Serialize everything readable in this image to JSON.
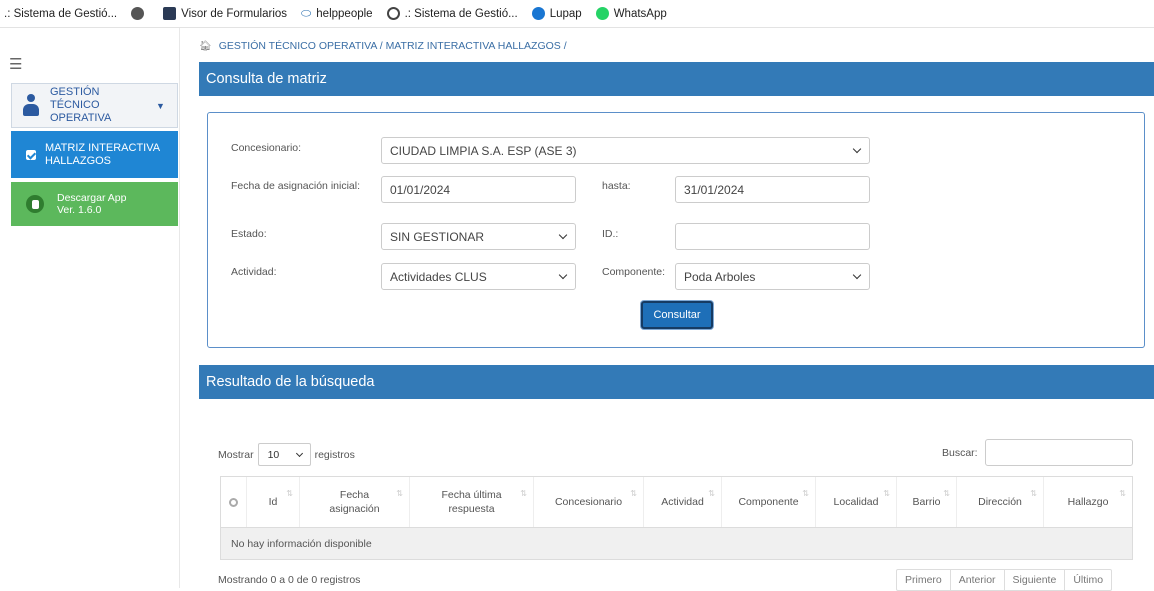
{
  "bookmarks": [
    {
      "label": ".: Sistema de Gestió...",
      "icon": "none"
    },
    {
      "label": "",
      "icon": "chrome-icon"
    },
    {
      "label": "Visor de Formularios",
      "icon": "document-icon"
    },
    {
      "label": "helppeople",
      "icon": "link-icon"
    },
    {
      "label": ".: Sistema de Gestió...",
      "icon": "owl-icon"
    },
    {
      "label": "Lupap",
      "icon": "globe-icon"
    },
    {
      "label": "WhatsApp",
      "icon": "whatsapp-icon"
    }
  ],
  "sidebar": {
    "group": "GESTIÓN TÉCNICO OPERATIVA",
    "active_item": "MATRIZ INTERACTIVA HALLAZGOS",
    "app_item": {
      "line1": "Descargar App",
      "line2": "Ver. 1.6.0"
    },
    "colors": {
      "active": "#1f86d4",
      "app": "#5cb85c"
    }
  },
  "breadcrumb": "GESTIÓN TÉCNICO OPERATIVA / MATRIZ INTERACTIVA HALLAZGOS /",
  "query_panel": {
    "title": "Consulta de matriz",
    "concesionario_label": "Concesionario:",
    "concesionario_value": "CIUDAD LIMPIA S.A. ESP (ASE 3)",
    "fecha_label": "Fecha de asignación inicial:",
    "fecha_value": "01/01/2024",
    "hasta_label": "hasta:",
    "hasta_value": "31/01/2024",
    "estado_label": "Estado:",
    "estado_value": "SIN GESTIONAR",
    "id_label": "ID.:",
    "id_value": "",
    "actividad_label": "Actividad:",
    "actividad_value": "Actividades CLUS",
    "componente_label": "Componente:",
    "componente_value": "Poda Arboles",
    "submit_label": "Consultar"
  },
  "results_panel": {
    "title": "Resultado de la búsqueda",
    "show_prefix": "Mostrar",
    "page_length": "10",
    "show_suffix": "registros",
    "search_label": "Buscar:",
    "columns": [
      "Id",
      "Fecha asignación",
      "Fecha última respuesta",
      "Concesionario",
      "Actividad",
      "Componente",
      "Localidad",
      "Barrio",
      "Dirección",
      "Hallazgo"
    ],
    "empty_message": "No hay información disponible",
    "info": "Mostrando 0 a 0 de 0 registros",
    "pager": [
      "Primero",
      "Anterior",
      "Siguiente",
      "Último"
    ]
  },
  "colors": {
    "header": "#337ab7",
    "link": "#3a6ea5"
  }
}
